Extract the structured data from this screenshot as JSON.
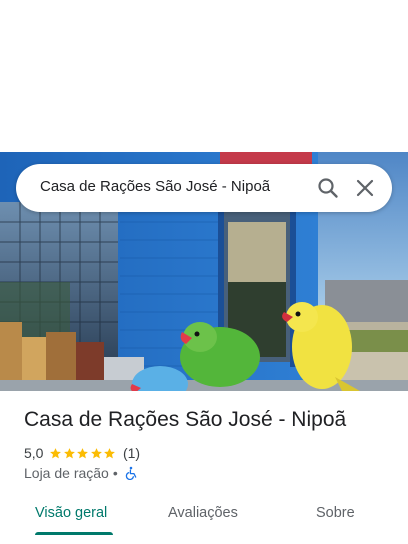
{
  "search": {
    "query": "Casa de Rações São José - Nipoã"
  },
  "place": {
    "title": "Casa de Rações São José - Nipoã",
    "rating_value": "5,0",
    "rating_stars": 5,
    "rating_count": "(1)",
    "category": "Loja de ração",
    "separator": "•",
    "accessibility_icon": "wheelchair-icon"
  },
  "tabs": [
    {
      "label": "Visão geral",
      "active": true
    },
    {
      "label": "Avaliações",
      "active": false
    },
    {
      "label": "Sobre",
      "active": false
    }
  ],
  "colors": {
    "accent": "#00796b",
    "star": "#fbbc04",
    "accessibility": "#1a73e8"
  }
}
